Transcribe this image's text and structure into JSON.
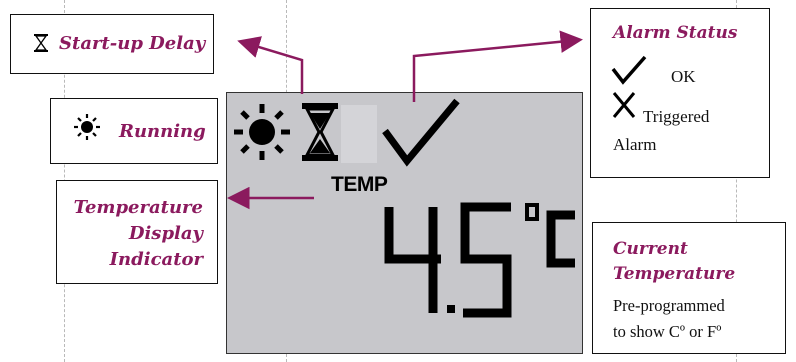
{
  "labels": {
    "startup_delay": "Start-up Delay",
    "running": "Running",
    "temp_display": [
      "Temperature",
      "Display",
      "Indicator"
    ],
    "alarm_title": "Alarm Status",
    "ok": "OK",
    "triggered": "Triggered",
    "alarm": "Alarm",
    "current_temp": [
      "Current",
      "Temperature"
    ],
    "preprogrammed": [
      "Pre-programmed",
      "to show Cº or Fº"
    ]
  },
  "lcd": {
    "temp_tag": "TEMP",
    "reading": "4.5",
    "unit": "°C"
  },
  "colors": {
    "accent": "#8b1a5e",
    "lcd_bg": "#c7c7cb",
    "arrow": "#8b1a5e"
  },
  "icons": [
    "hourglass-icon",
    "sun-icon",
    "checkmark-icon",
    "cross-icon"
  ]
}
